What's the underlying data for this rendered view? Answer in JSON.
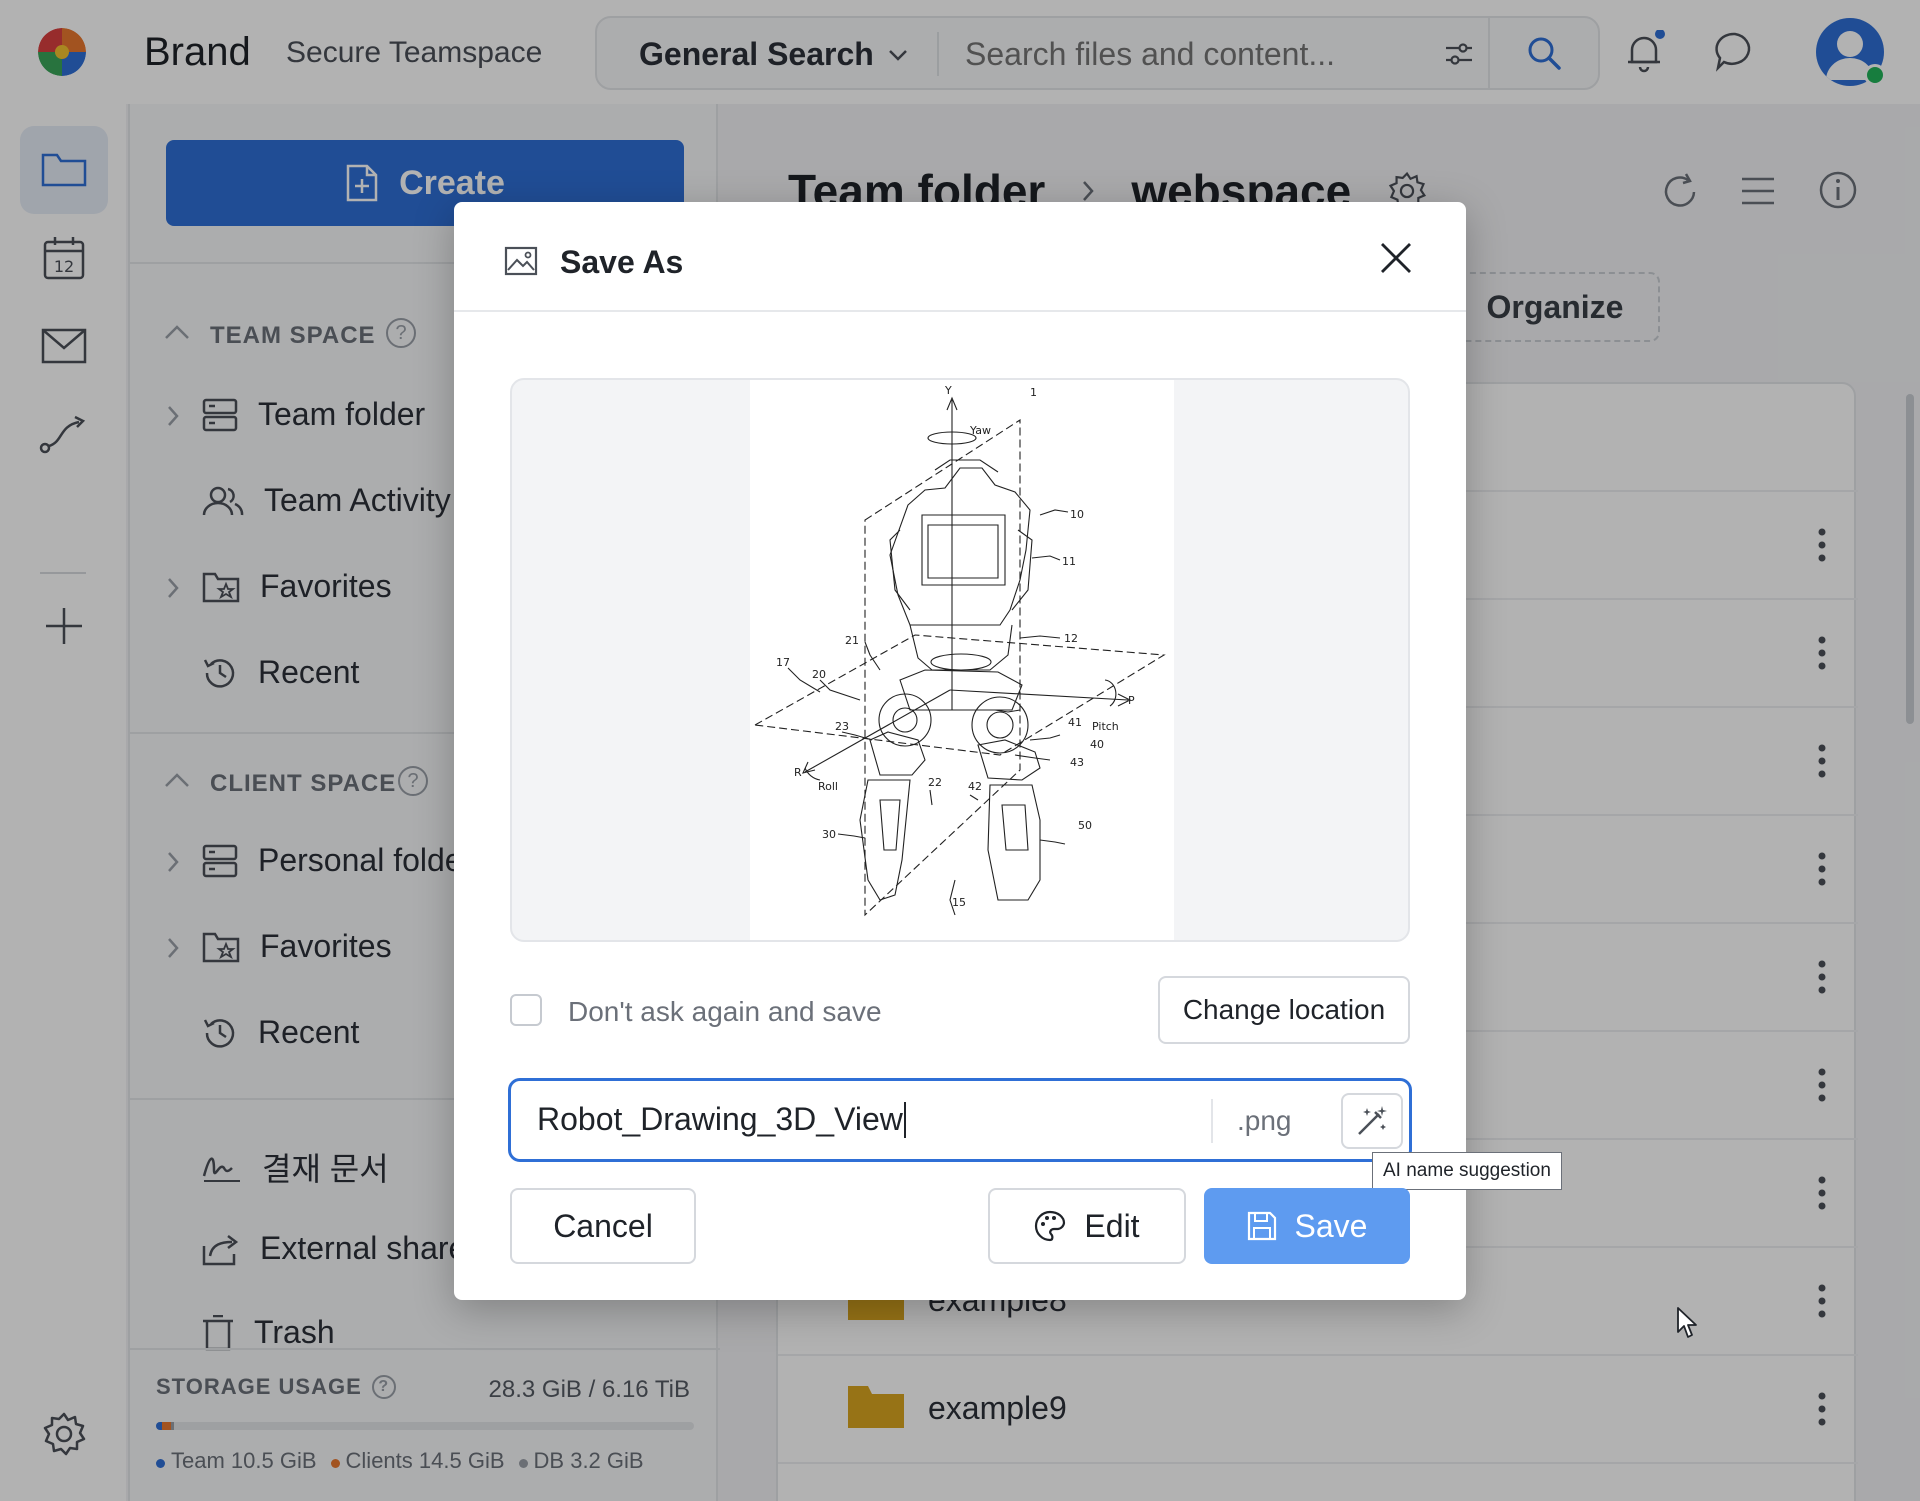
{
  "app": {
    "brand": "Brand",
    "workspace": "Secure Teamspace",
    "search_scope": "General Search",
    "search_placeholder": "Search files and content..."
  },
  "colors": {
    "primary": "#2f6fd6",
    "save_button": "#5e9bf0",
    "online": "#22b35a",
    "notification_dot": "#2f6fd6",
    "folder": "#d9a520"
  },
  "sidebar": {
    "create_label": "Create",
    "team_space_title": "TEAM SPACE",
    "team_items": [
      "Team folder",
      "Team Activity",
      "Favorites",
      "Recent"
    ],
    "client_space_title": "CLIENT SPACE",
    "client_items": [
      "Personal folde",
      "Favorites",
      "Recent"
    ],
    "other_items": [
      "결재 문서",
      "External share",
      "Trash"
    ],
    "storage": {
      "label": "STORAGE USAGE",
      "value": "28.3 GiB / 6.16 TiB",
      "legend": [
        {
          "name": "Team",
          "size": "10.5 GiB",
          "color": "#2f6fd6"
        },
        {
          "name": "Clients",
          "size": "14.5 GiB",
          "color": "#e8772e"
        },
        {
          "name": "DB",
          "size": "3.2 GiB",
          "color": "#9aa0a8"
        }
      ]
    }
  },
  "main": {
    "breadcrumb": [
      "Team folder",
      "webspace"
    ],
    "organize_label": "Organize",
    "rows": [
      "example8",
      "example9"
    ]
  },
  "dialog": {
    "title": "Save As",
    "dont_ask_label": "Don't ask again and save",
    "dont_ask_checked": false,
    "change_location_label": "Change location",
    "filename": "Robot_Drawing_3D_View",
    "extension": ".png",
    "ai_tooltip": "AI name suggestion",
    "cancel_label": "Cancel",
    "edit_label": "Edit",
    "save_label": "Save",
    "preview_labels": {
      "axis_y": "Y",
      "yaw": "Yaw",
      "pitch": "Pitch",
      "axis_p": "P",
      "roll": "Roll",
      "axis_r": "R",
      "ref_1": "1",
      "ref_10": "10",
      "ref_11": "11",
      "ref_12": "12",
      "ref_15": "15",
      "ref_17": "17",
      "ref_20": "20",
      "ref_21": "21",
      "ref_22": "22",
      "ref_23": "23",
      "ref_30": "30",
      "ref_40": "40",
      "ref_41": "41",
      "ref_42": "42",
      "ref_43": "43",
      "ref_50": "50"
    }
  }
}
